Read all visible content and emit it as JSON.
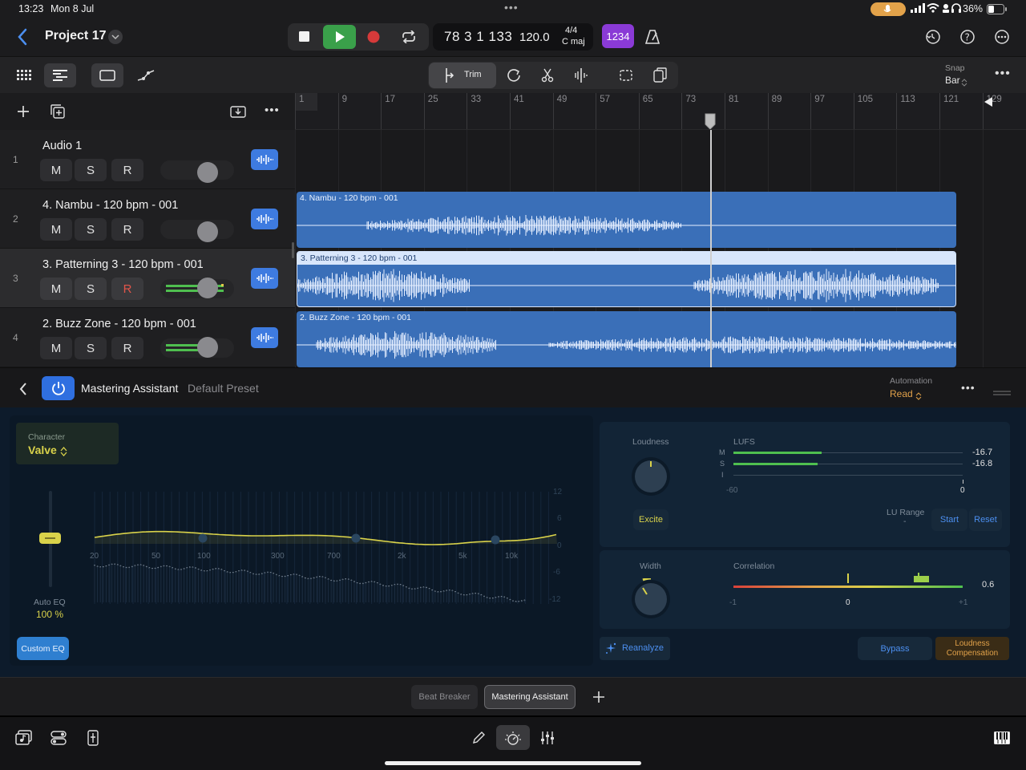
{
  "status": {
    "time": "13:23",
    "date": "Mon 8 Jul",
    "battery": "36%"
  },
  "header": {
    "project_title": "Project 17",
    "lcd": {
      "position": "78 3 1 133",
      "tempo": "120.0",
      "signature": "4/4",
      "key": "C maj"
    },
    "count_in": "1234"
  },
  "toolbar": {
    "trim_label": "Trim",
    "snap_label": "Snap",
    "snap_value": "Bar"
  },
  "ruler": {
    "bars": [
      "1",
      "9",
      "17",
      "25",
      "33",
      "41",
      "49",
      "57",
      "65",
      "73",
      "81",
      "89",
      "97",
      "105",
      "113",
      "121",
      "129"
    ]
  },
  "tracks": [
    {
      "num": "1",
      "name": "Audio 1",
      "mute": "M",
      "solo": "S",
      "rec": "R"
    },
    {
      "num": "2",
      "name": "4. Nambu - 120 bpm - 001",
      "mute": "M",
      "solo": "S",
      "rec": "R"
    },
    {
      "num": "3",
      "name": "3. Patterning 3 - 120 bpm - 001",
      "mute": "M",
      "solo": "S",
      "rec": "R"
    },
    {
      "num": "4",
      "name": "2. Buzz Zone - 120 bpm - 001",
      "mute": "M",
      "solo": "S",
      "rec": "R"
    }
  ],
  "regions": [
    {
      "title": "4. Nambu - 120 bpm - 001"
    },
    {
      "title": "3. Patterning 3 - 120 bpm - 001"
    },
    {
      "title": "2. Buzz Zone - 120 bpm - 001"
    }
  ],
  "plugin": {
    "name": "Mastering Assistant",
    "preset": "Default Preset",
    "automation_label": "Automation",
    "automation_value": "Read",
    "character_label": "Character",
    "character_value": "Valve",
    "auto_eq_label": "Auto EQ",
    "auto_eq_value": "100 %",
    "custom_eq": "Custom EQ",
    "freq_labels": [
      "20",
      "50",
      "100",
      "300",
      "700",
      "2k",
      "5k",
      "10k"
    ],
    "db_labels": [
      "12",
      "6",
      "0",
      "-6",
      "-12"
    ],
    "loudness_label": "Loudness",
    "lufs_label": "LUFS",
    "meter_m": "M",
    "meter_s": "S",
    "meter_i": "I",
    "lufs_m_value": "-16.7",
    "lufs_s_value": "-16.8",
    "lufs_min": "-60",
    "lufs_max": "0",
    "excite": "Excite",
    "lu_range_label": "LU Range",
    "lu_range_value": "-",
    "start": "Start",
    "reset": "Reset",
    "width_label": "Width",
    "correlation_label": "Correlation",
    "correlation_value": "0.6",
    "corr_min": "-1",
    "corr_mid": "0",
    "corr_max": "+1",
    "reanalyze": "Reanalyze",
    "bypass": "Bypass",
    "loudness_comp_1": "Loudness",
    "loudness_comp_2": "Compensation"
  },
  "plugin_tabs": [
    "Beat Breaker",
    "Mastering Assistant"
  ],
  "colors": {
    "accent_blue": "#3e7be0",
    "play_green": "#3aa04a",
    "record_red": "#d63a3a",
    "count_in_purple": "#8a3ad6",
    "eq_yellow": "#d9d24a",
    "orange": "#e2a24a"
  }
}
